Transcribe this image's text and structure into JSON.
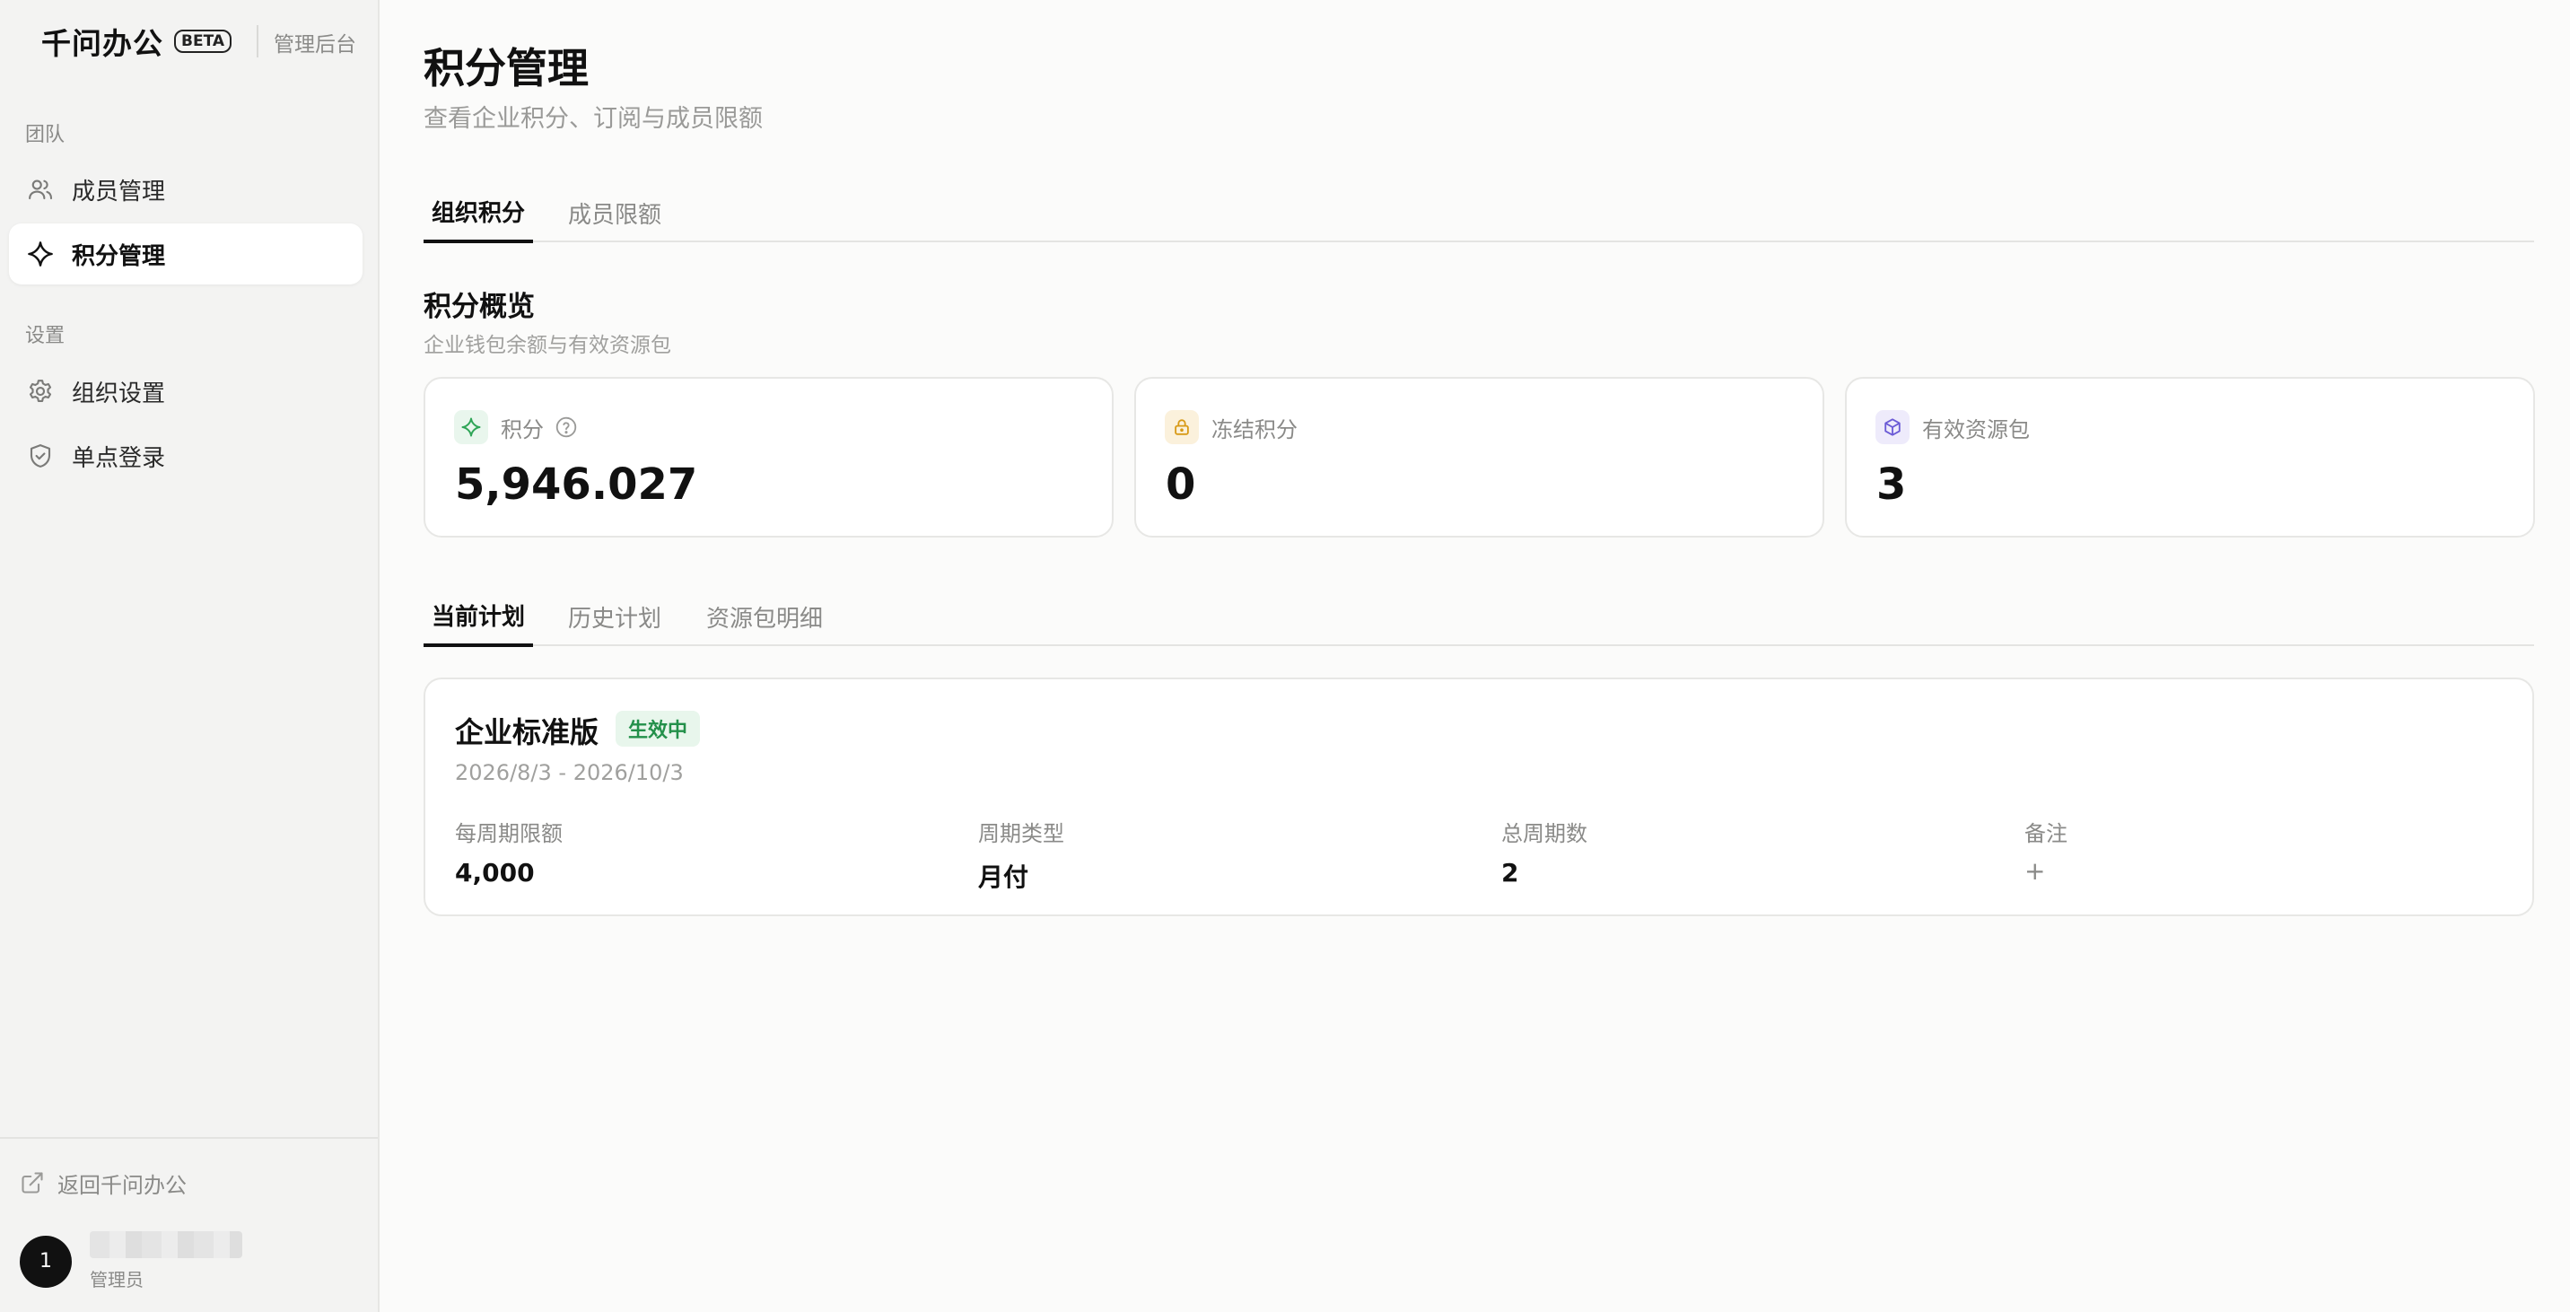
{
  "brand": {
    "name": "千问办公",
    "badge": "BETA",
    "subtitle": "管理后台"
  },
  "sidebar": {
    "groups": [
      {
        "label": "团队",
        "items": [
          {
            "label": "成员管理",
            "icon": "users-icon",
            "active": false
          },
          {
            "label": "积分管理",
            "icon": "sparkle-icon",
            "active": true
          }
        ]
      },
      {
        "label": "设置",
        "items": [
          {
            "label": "组织设置",
            "icon": "gear-icon",
            "active": false
          },
          {
            "label": "单点登录",
            "icon": "shield-check-icon",
            "active": false
          }
        ]
      }
    ],
    "back_link": {
      "label": "返回千问办公",
      "icon": "external-link-icon"
    },
    "user": {
      "avatar_text": "1",
      "role": "管理员"
    }
  },
  "page": {
    "title": "积分管理",
    "subtitle": "查看企业积分、订阅与成员限额",
    "tabs": [
      {
        "label": "组织积分",
        "active": true
      },
      {
        "label": "成员限额",
        "active": false
      }
    ]
  },
  "overview": {
    "title": "积分概览",
    "subtitle": "企业钱包余额与有效资源包",
    "cards": [
      {
        "label": "积分",
        "value": "5,946.027",
        "icon": "sparkle-icon",
        "has_help": true,
        "accent": "#2fa557"
      },
      {
        "label": "冻结积分",
        "value": "0",
        "icon": "lock-icon",
        "has_help": false,
        "accent": "#d89a17"
      },
      {
        "label": "有效资源包",
        "value": "3",
        "icon": "package-icon",
        "has_help": false,
        "accent": "#6b5bd6"
      }
    ]
  },
  "plans": {
    "tabs": [
      {
        "label": "当前计划",
        "active": true
      },
      {
        "label": "历史计划",
        "active": false
      },
      {
        "label": "资源包明细",
        "active": false
      }
    ],
    "current": {
      "name": "企业标准版",
      "status": "生效中",
      "date_range": "2026/8/3 - 2026/10/3",
      "fields": [
        {
          "key": "每周期限额",
          "value": "4,000"
        },
        {
          "key": "周期类型",
          "value": "月付"
        },
        {
          "key": "总周期数",
          "value": "2"
        },
        {
          "key": "备注",
          "value": "+"
        }
      ]
    }
  }
}
